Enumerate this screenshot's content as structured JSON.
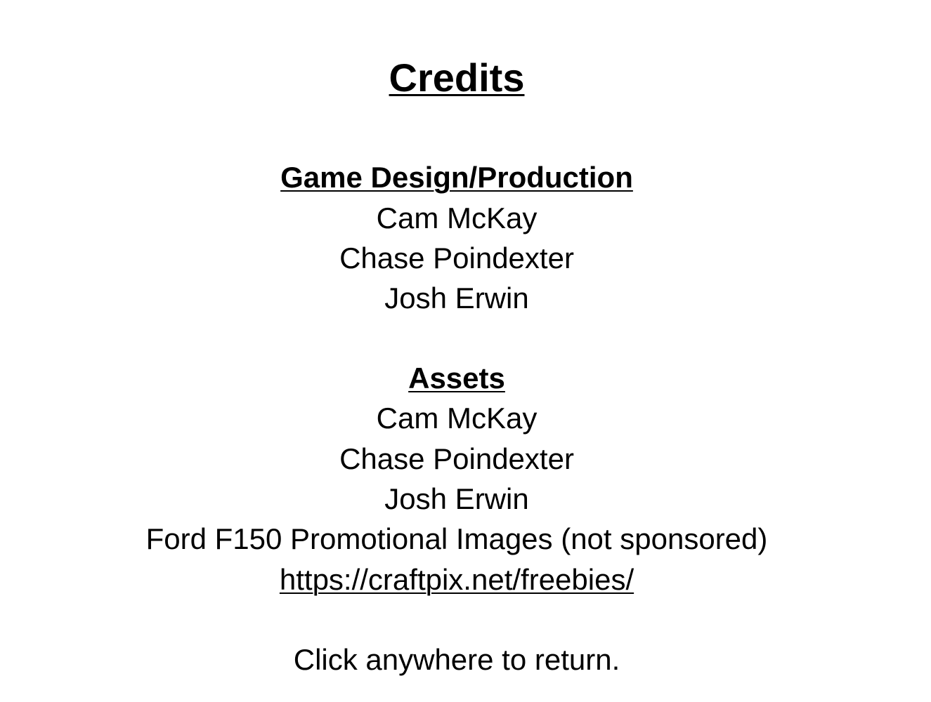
{
  "title": "Credits",
  "sections": [
    {
      "heading": "Game Design/Production",
      "entries": [
        "Cam McKay",
        "Chase Poindexter",
        "Josh Erwin"
      ]
    },
    {
      "heading": "Assets",
      "entries": [
        "Cam McKay",
        "Chase Poindexter",
        "Josh Erwin",
        "Ford F150 Promotional Images (not sponsored)"
      ],
      "link": "https://craftpix.net/freebies/"
    }
  ],
  "footer": "Click anywhere to return."
}
